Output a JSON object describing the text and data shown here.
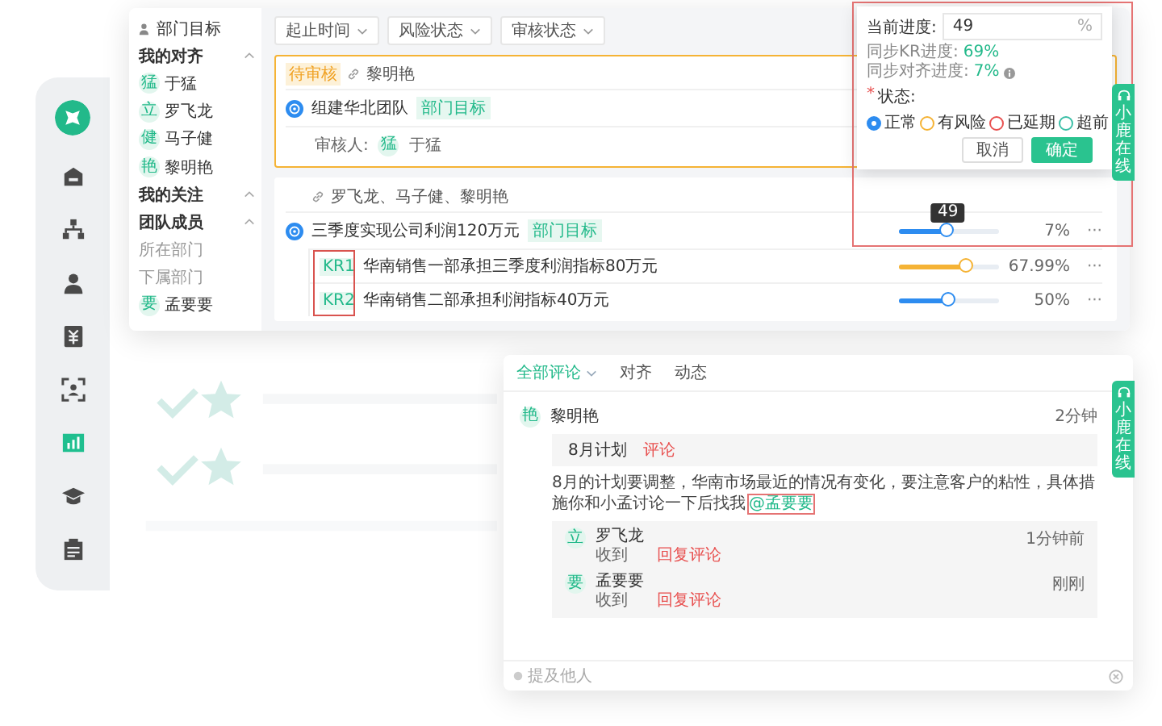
{
  "rail": [
    {
      "kind": "logo",
      "selected": false
    },
    {
      "kind": "home",
      "selected": false
    },
    {
      "kind": "org",
      "selected": false
    },
    {
      "kind": "person",
      "selected": false
    },
    {
      "kind": "money",
      "selected": false
    },
    {
      "kind": "scan",
      "selected": false
    },
    {
      "kind": "chart",
      "selected": true
    },
    {
      "kind": "education",
      "selected": false
    },
    {
      "kind": "report",
      "selected": false
    }
  ],
  "nav": [
    {
      "kind": "title",
      "label": "部门目标"
    },
    {
      "kind": "group",
      "label": "我的对齐",
      "expanded": true
    },
    {
      "kind": "member",
      "avatar": "猛",
      "label": "于猛"
    },
    {
      "kind": "member",
      "avatar": "立",
      "label": "罗飞龙"
    },
    {
      "kind": "member",
      "avatar": "健",
      "label": "马子健"
    },
    {
      "kind": "member",
      "avatar": "艳",
      "label": "黎明艳"
    },
    {
      "kind": "group",
      "label": "我的关注",
      "expanded": true
    },
    {
      "kind": "group",
      "label": "团队成员",
      "expanded": true
    },
    {
      "kind": "sub",
      "label": "所在部门"
    },
    {
      "kind": "sub",
      "label": "下属部门"
    },
    {
      "kind": "member",
      "avatar": "要",
      "label": "孟要要"
    }
  ],
  "filters": [
    "起止时间",
    "风险状态",
    "审核状态"
  ],
  "objectives": [
    {
      "status": "待审核",
      "aligned": "黎明艳",
      "title": "组建华北团队",
      "tag": "部门目标",
      "reviewer_label": "审核人:",
      "reviewer": {
        "avatar": "猛",
        "name": "于猛"
      }
    },
    {
      "aligned": "罗飞龙、马子健、黎明艳",
      "title": "三季度实现公司利润120万元",
      "tag": "部门目标",
      "level": 0.49,
      "color": "#2d8cf0",
      "reading": "7%",
      "menu": "···",
      "tooltip": "49",
      "key_results": [
        {
          "code": "KR1",
          "title": "华南销售一部承担三季度利润指标80万元",
          "level": 0.6799,
          "color": "#f5b335",
          "reading": "67.99%",
          "menu": "···"
        },
        {
          "code": "KR2",
          "title": "华南销售二部承担利润指标40万元",
          "level": 0.5,
          "color": "#2d8cf0",
          "reading": "50%",
          "menu": "···"
        }
      ]
    }
  ],
  "popup": {
    "label": "当前进度:",
    "value": "49",
    "unit": "%",
    "sync": [
      {
        "label": "同步KR进度:",
        "value": "69%"
      },
      {
        "label": "同步对齐进度:",
        "value": "7%"
      }
    ],
    "required": "*",
    "status_label": "状态:",
    "options": [
      {
        "label": "正常",
        "color": "#2d8cf0",
        "selected": true
      },
      {
        "label": "有风险",
        "color": "#f5b335",
        "selected": false
      },
      {
        "label": "已延期",
        "color": "#e8504f",
        "selected": false
      },
      {
        "label": "超前",
        "color": "#3bbfa7",
        "selected": false
      }
    ],
    "buttons": [
      {
        "label": "取消",
        "kind": "secondary"
      },
      {
        "label": "确定",
        "kind": "primary"
      }
    ]
  },
  "help_tabs": [
    {
      "label": "小鹿在线"
    },
    {
      "label": "小鹿在线"
    }
  ],
  "comments": {
    "tabs": [
      {
        "label": "全部评论",
        "selected": true,
        "dropdown": true
      },
      {
        "label": "对齐",
        "selected": false
      },
      {
        "label": "动态",
        "selected": false
      }
    ],
    "author": {
      "avatar": "艳",
      "name": "黎明艳",
      "time": "2分钟"
    },
    "quote": {
      "title": "8月计划",
      "action": "评论"
    },
    "body": "8月的计划要调整，华南市场最近的情况有变化，要注意客户的粘性，具体措施你和小孟讨论一下后找我",
    "mention": "@孟要要",
    "replies": [
      {
        "avatar": "立",
        "name": "罗飞龙",
        "text": "收到",
        "action": "回复评论",
        "time": "1分钟前"
      },
      {
        "avatar": "要",
        "name": "孟要要",
        "text": "收到",
        "action": "回复评论",
        "time": "刚刚"
      }
    ],
    "input": {
      "placeholder": "提及他人"
    }
  }
}
